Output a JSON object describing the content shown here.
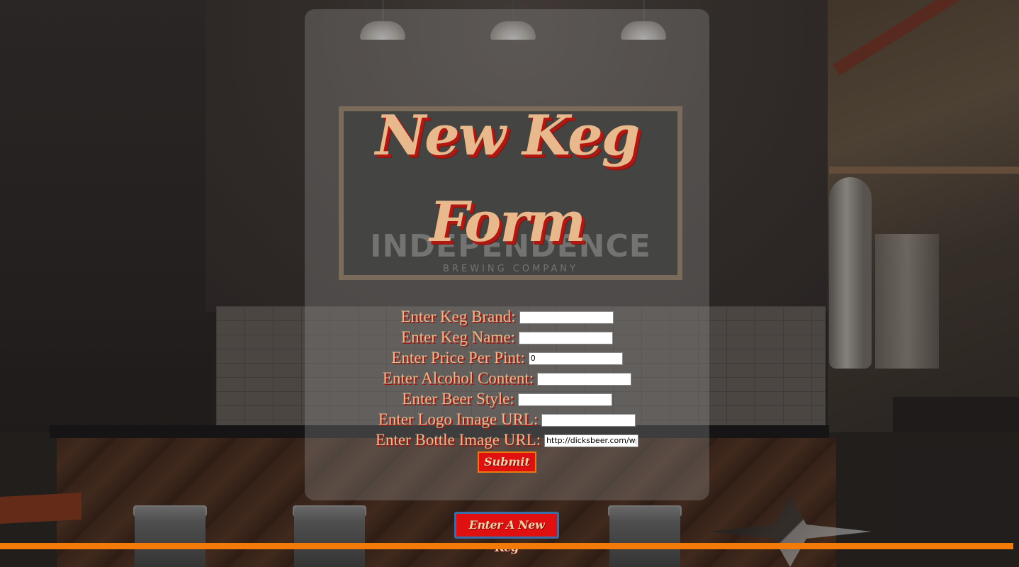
{
  "page": {
    "title_line1": "New Keg",
    "title_line2": "Form"
  },
  "form": {
    "fields": [
      {
        "label": "Enter Keg Brand:",
        "value": "",
        "placeholder": ""
      },
      {
        "label": "Enter Keg Name:",
        "value": "",
        "placeholder": ""
      },
      {
        "label": "Enter Price Per Pint:",
        "value": "0",
        "placeholder": ""
      },
      {
        "label": "Enter Alcohol Content:",
        "value": "",
        "placeholder": ""
      },
      {
        "label": "Enter Beer Style:",
        "value": "",
        "placeholder": ""
      },
      {
        "label": "Enter Logo Image URL:",
        "value": "",
        "placeholder": ""
      },
      {
        "label": "Enter Bottle Image URL:",
        "value": "http://dicksbeer.com/wp",
        "placeholder": ""
      }
    ],
    "submit_label": "Submit"
  },
  "actions": {
    "new_keg_label": "Enter A New Keg"
  },
  "background": {
    "sign_title": "INDEPENDENCE",
    "sign_subtitle": "BREWING COMPANY"
  },
  "colors": {
    "title": "#e8b98c",
    "title_shadow": "#b01812",
    "button_bg": "#e01010",
    "button_border": "#e87a10",
    "new_keg_border": "#3a6ea8",
    "footer_bar": "#f47a08"
  }
}
